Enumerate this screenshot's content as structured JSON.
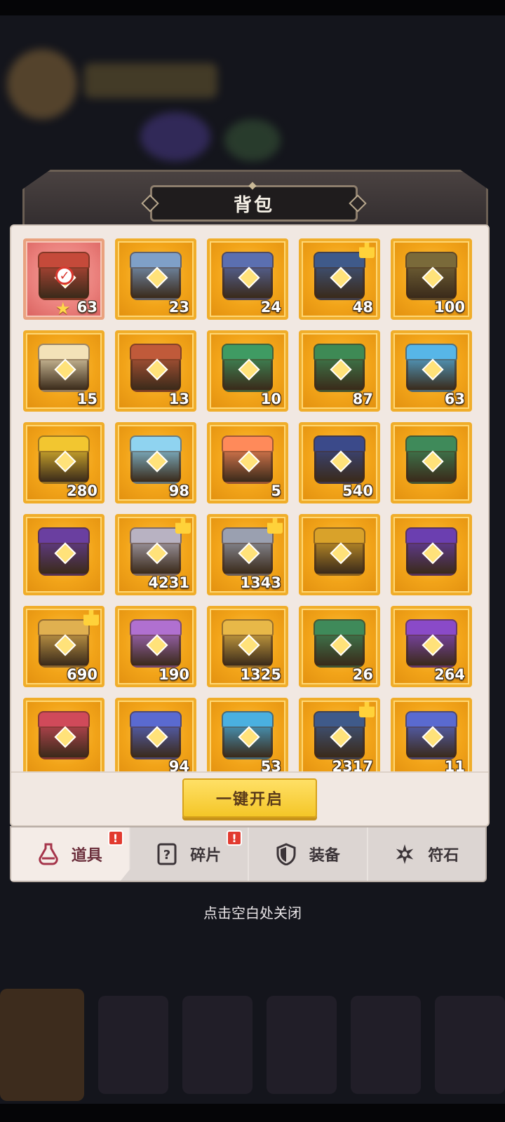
{
  "panel": {
    "title": "背包"
  },
  "items": [
    {
      "count": "63",
      "color": "#c54a3a",
      "selected": true,
      "star": true,
      "check": true
    },
    {
      "count": "23",
      "color": "#7fa0c8"
    },
    {
      "count": "24",
      "color": "#5b6fb0"
    },
    {
      "count": "48",
      "color": "#3f5a8a",
      "fragment": true
    },
    {
      "count": "100",
      "color": "#7a6a3a"
    },
    {
      "count": "15",
      "color": "#f3e2b8"
    },
    {
      "count": "13",
      "color": "#c05a3a"
    },
    {
      "count": "10",
      "color": "#3f9b63"
    },
    {
      "count": "87",
      "color": "#3e8a55"
    },
    {
      "count": "63",
      "color": "#57b6e8"
    },
    {
      "count": "280",
      "color": "#f2c630"
    },
    {
      "count": "98",
      "color": "#8fd3f0"
    },
    {
      "count": "5",
      "color": "#ff8a5a"
    },
    {
      "count": "540",
      "color": "#3b4a8a"
    },
    {
      "count": "",
      "color": "#3f8a5a"
    },
    {
      "count": "",
      "color": "#6a3fa0"
    },
    {
      "count": "4231",
      "color": "#b8b2c2",
      "fragment": true
    },
    {
      "count": "1343",
      "color": "#9aa0b0",
      "fragment": true
    },
    {
      "count": "",
      "color": "#d9a22a"
    },
    {
      "count": "",
      "color": "#6b3fb0"
    },
    {
      "count": "690",
      "color": "#e0b050",
      "fragment": true
    },
    {
      "count": "190",
      "color": "#b070d0"
    },
    {
      "count": "1325",
      "color": "#e8b848"
    },
    {
      "count": "26",
      "color": "#3f8a5a"
    },
    {
      "count": "264",
      "color": "#8a4ac8"
    },
    {
      "count": "",
      "color": "#d04a5a"
    },
    {
      "count": "94",
      "color": "#5a6ad0"
    },
    {
      "count": "53",
      "color": "#4ab0e0"
    },
    {
      "count": "2317",
      "color": "#3f5a8a",
      "fragment": true
    },
    {
      "count": "11",
      "color": "#5a6ad0"
    }
  ],
  "actions": {
    "open_all": "一键开启"
  },
  "tabs": [
    {
      "label": "道具",
      "icon": "potion-icon",
      "active": true,
      "alert": "!"
    },
    {
      "label": "碎片",
      "icon": "question-card-icon",
      "alert": "!"
    },
    {
      "label": "装备",
      "icon": "shield-icon"
    },
    {
      "label": "符石",
      "icon": "rune-star-icon"
    }
  ],
  "hint": "点击空白处关闭"
}
